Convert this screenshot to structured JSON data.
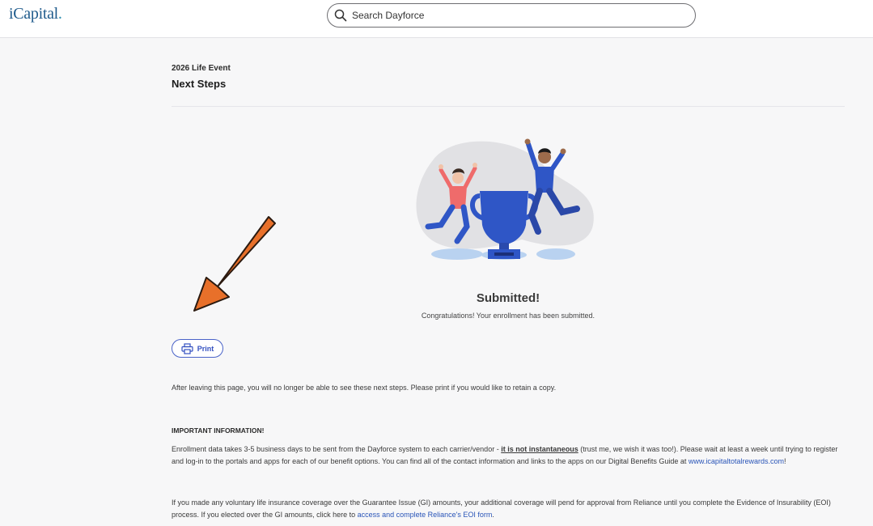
{
  "header": {
    "logo_text": "iCapital",
    "logo_dot": ".",
    "search_placeholder": "Search Dayforce"
  },
  "page": {
    "eyebrow": "2026 Life Event",
    "title": "Next Steps"
  },
  "confirmation": {
    "title": "Submitted!",
    "message": "Congratulations! Your enrollment has been submitted."
  },
  "print_button": {
    "label": "Print"
  },
  "note": "After leaving this page, you will no longer be able to see these next steps. Please print if you would like to retain a copy.",
  "important": {
    "heading": "IMPORTANT INFORMATION!",
    "p1_a": "Enrollment data takes 3-5 business days to be sent from the Dayforce system to each carrier/vendor - ",
    "p1_bold": "it is not instantaneous",
    "p1_b": " (trust me, we wish it was too!). Please wait at least a week until trying to register and log-in to the portals and apps for each of our benefit options. You can find all of the contact information and links to the apps on our Digital Benefits Guide at ",
    "p1_link": "www.icapitaltotalrewards.com",
    "p1_c": "!",
    "p2_a": "If you made any voluntary life insurance coverage over the Guarantee Issue (GI) amounts, your additional coverage will pend for approval from Reliance until you complete the Evidence of Insurability (EOI) process. If you elected over the GI amounts, click here to ",
    "p2_link": "access and complete Reliance's EOI form",
    "p2_b": "."
  },
  "colors": {
    "accent_blue": "#3451c0",
    "link_blue": "#2a55b8",
    "arrow_orange": "#e8702a",
    "logo_blue": "#1f5b8c"
  },
  "icons": [
    "search-icon",
    "printer-icon",
    "celebration-trophy-illustration",
    "annotation-arrow"
  ]
}
